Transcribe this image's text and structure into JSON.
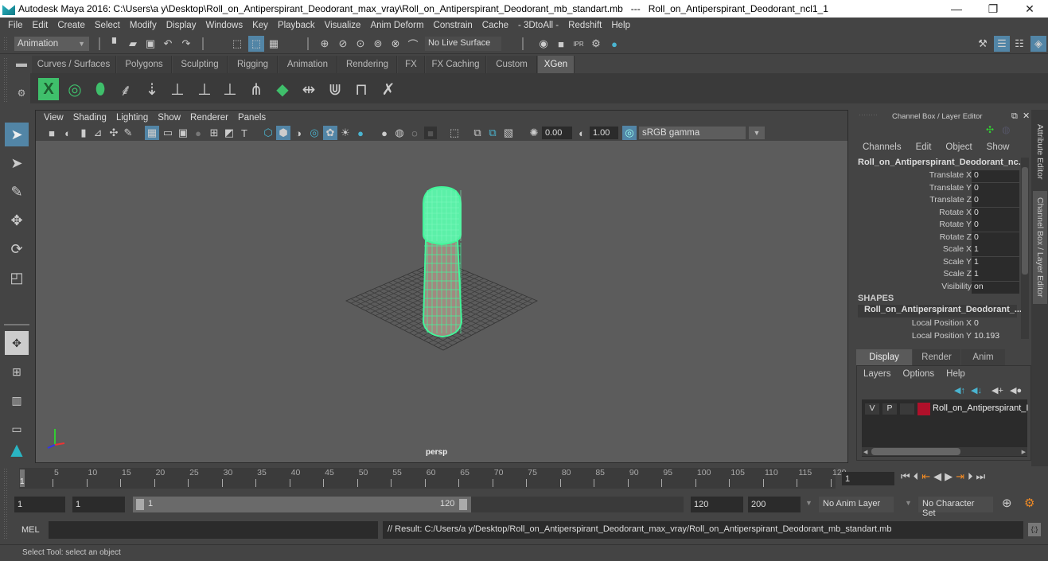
{
  "window": {
    "title": "Autodesk Maya 2016: C:\\Users\\a y\\Desktop\\Roll_on_Antiperspirant_Deodorant_max_vray\\Roll_on_Antiperspirant_Deodorant_mb_standart.mb   ---   Roll_on_Antiperspirant_Deodorant_ncl1_1",
    "minimize": "—",
    "restore": "❐",
    "close": "✕"
  },
  "menubar": [
    "File",
    "Edit",
    "Create",
    "Select",
    "Modify",
    "Display",
    "Windows",
    "Key",
    "Playback",
    "Visualize",
    "Anim Deform",
    "Constrain",
    "Cache",
    "- 3DtoAll -",
    "Redshift",
    "Help"
  ],
  "toolbar": {
    "menuset": "Animation",
    "live_surface": "No Live Surface"
  },
  "shelf_tabs": [
    "Curves / Surfaces",
    "Polygons",
    "Sculpting",
    "Rigging",
    "Animation",
    "Rendering",
    "FX",
    "FX Caching",
    "Custom",
    "XGen"
  ],
  "active_shelf_tab": "XGen",
  "viewport": {
    "menu": [
      "View",
      "Shading",
      "Lighting",
      "Show",
      "Renderer",
      "Panels"
    ],
    "exposure": "0.00",
    "gamma": "1.00",
    "color_space": "sRGB gamma",
    "camera_label": "persp"
  },
  "channel_box": {
    "title": "Channel Box / Layer Editor",
    "menu": [
      "Channels",
      "Edit",
      "Object",
      "Show"
    ],
    "object_name": "Roll_on_Antiperspirant_Deodorant_nc...",
    "channels": [
      {
        "label": "Translate X",
        "value": "0"
      },
      {
        "label": "Translate Y",
        "value": "0"
      },
      {
        "label": "Translate Z",
        "value": "0"
      },
      {
        "label": "Rotate X",
        "value": "0"
      },
      {
        "label": "Rotate Y",
        "value": "0"
      },
      {
        "label": "Rotate Z",
        "value": "0"
      },
      {
        "label": "Scale X",
        "value": "1"
      },
      {
        "label": "Scale Y",
        "value": "1"
      },
      {
        "label": "Scale Z",
        "value": "1"
      },
      {
        "label": "Visibility",
        "value": "on"
      }
    ],
    "shapes_header": "SHAPES",
    "shape_name": "Roll_on_Antiperspirant_Deodorant_...",
    "shape_channels": [
      {
        "label": "Local Position X",
        "value": "0"
      },
      {
        "label": "Local Position Y",
        "value": "10.193"
      }
    ]
  },
  "layer_editor": {
    "tabs": [
      "Display",
      "Render",
      "Anim"
    ],
    "active_tab": "Display",
    "menu": [
      "Layers",
      "Options",
      "Help"
    ],
    "layers": [
      {
        "v": "V",
        "p": "P",
        "color": "#b0102a",
        "name": "Roll_on_Antiperspirant_I"
      }
    ]
  },
  "side_tabs": [
    "Attribute Editor",
    "Channel Box / Layer Editor"
  ],
  "timeline": {
    "ticks": [
      5,
      10,
      15,
      20,
      25,
      30,
      35,
      40,
      45,
      50,
      55,
      60,
      65,
      70,
      75,
      80,
      85,
      90,
      95,
      100,
      105,
      110,
      115,
      120
    ],
    "current_frame_marker": "1",
    "current_frame": "1"
  },
  "range": {
    "start": "1",
    "playback_start": "1",
    "slider_start": "1",
    "slider_end": "120",
    "playback_end": "120",
    "end": "200",
    "anim_layer": "No Anim Layer",
    "character_set": "No Character Set"
  },
  "command_line": {
    "label": "MEL",
    "input": "",
    "result": "// Result: C:/Users/a y/Desktop/Roll_on_Antiperspirant_Deodorant_max_vray/Roll_on_Antiperspirant_Deodorant_mb_standart.mb"
  },
  "help_line": "Select Tool: select an object",
  "colors": {
    "accent": "#5285a6",
    "selection": "#43f59a",
    "layer": "#b0102a"
  }
}
